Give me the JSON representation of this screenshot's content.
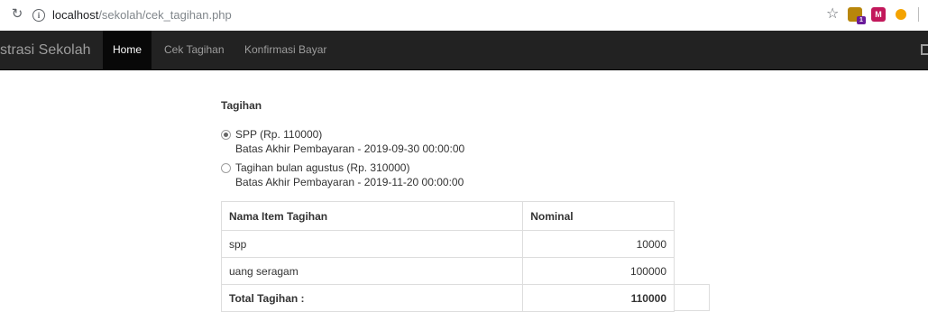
{
  "browser": {
    "url_host": "localhost",
    "url_path": "/sekolah/cek_tagihan.php",
    "extension_badge": "1",
    "extension2_letter": "M"
  },
  "navbar": {
    "brand": "strasi Sekolah",
    "items": [
      {
        "label": "Home",
        "active": true
      },
      {
        "label": "Cek Tagihan",
        "active": false
      },
      {
        "label": "Konfirmasi Bayar",
        "active": false
      }
    ]
  },
  "tagihan": {
    "heading": "Tagihan",
    "options": [
      {
        "label": "SPP (Rp. 110000)",
        "due": "Batas Akhir Pembayaran - 2019-09-30 00:00:00",
        "checked": true
      },
      {
        "label": "Tagihan bulan agustus (Rp. 310000)",
        "due": "Batas Akhir Pembayaran - 2019-11-20 00:00:00",
        "checked": false
      }
    ]
  },
  "table": {
    "headers": [
      "Nama Item Tagihan",
      "Nominal"
    ],
    "rows": [
      {
        "name": "spp",
        "nominal": "10000"
      },
      {
        "name": "uang seragam",
        "nominal": "100000"
      }
    ],
    "total_label": "Total Tagihan :",
    "total_value": "110000"
  },
  "colors": {
    "navbar_bg": "#222222",
    "navbar_active_bg": "#080808",
    "navbar_text": "#9d9d9d"
  }
}
